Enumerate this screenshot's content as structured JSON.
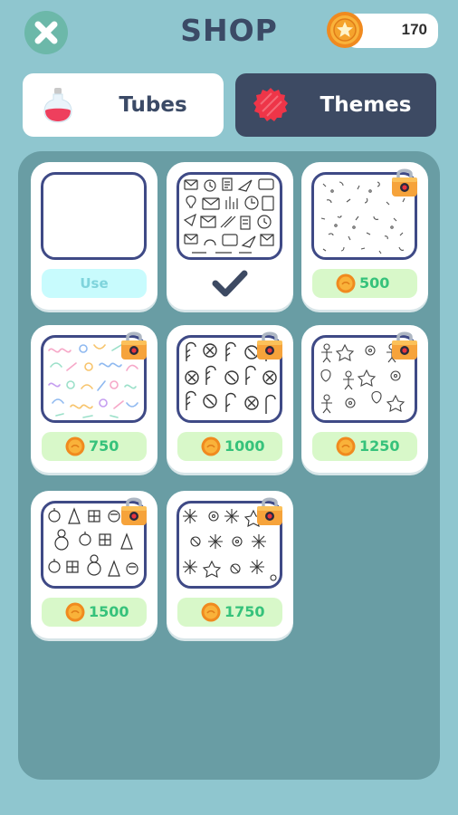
{
  "header": {
    "title": "SHOP",
    "coins": "170"
  },
  "tabs": [
    {
      "label": "Tubes",
      "active": false
    },
    {
      "label": "Themes",
      "active": true
    }
  ],
  "themes": [
    {
      "pattern": "blank",
      "status": "owned",
      "action_label": "Use"
    },
    {
      "pattern": "office-doodles",
      "status": "selected"
    },
    {
      "pattern": "confetti-dots",
      "status": "locked",
      "price": "500"
    },
    {
      "pattern": "colorful-squiggles",
      "status": "locked",
      "price": "750"
    },
    {
      "pattern": "candy-canes",
      "status": "locked",
      "price": "1000"
    },
    {
      "pattern": "gingerbread",
      "status": "locked",
      "price": "1250"
    },
    {
      "pattern": "christmas-ornaments",
      "status": "locked",
      "price": "1500"
    },
    {
      "pattern": "snowflakes",
      "status": "locked",
      "price": "1750"
    }
  ],
  "colors": {
    "background": "#8fc6cf",
    "panel": "#699da4",
    "title": "#3b4a66",
    "active_tab": "#3d4a63",
    "price_green": "#36c27b",
    "coin_orange": "#f5a32c"
  }
}
